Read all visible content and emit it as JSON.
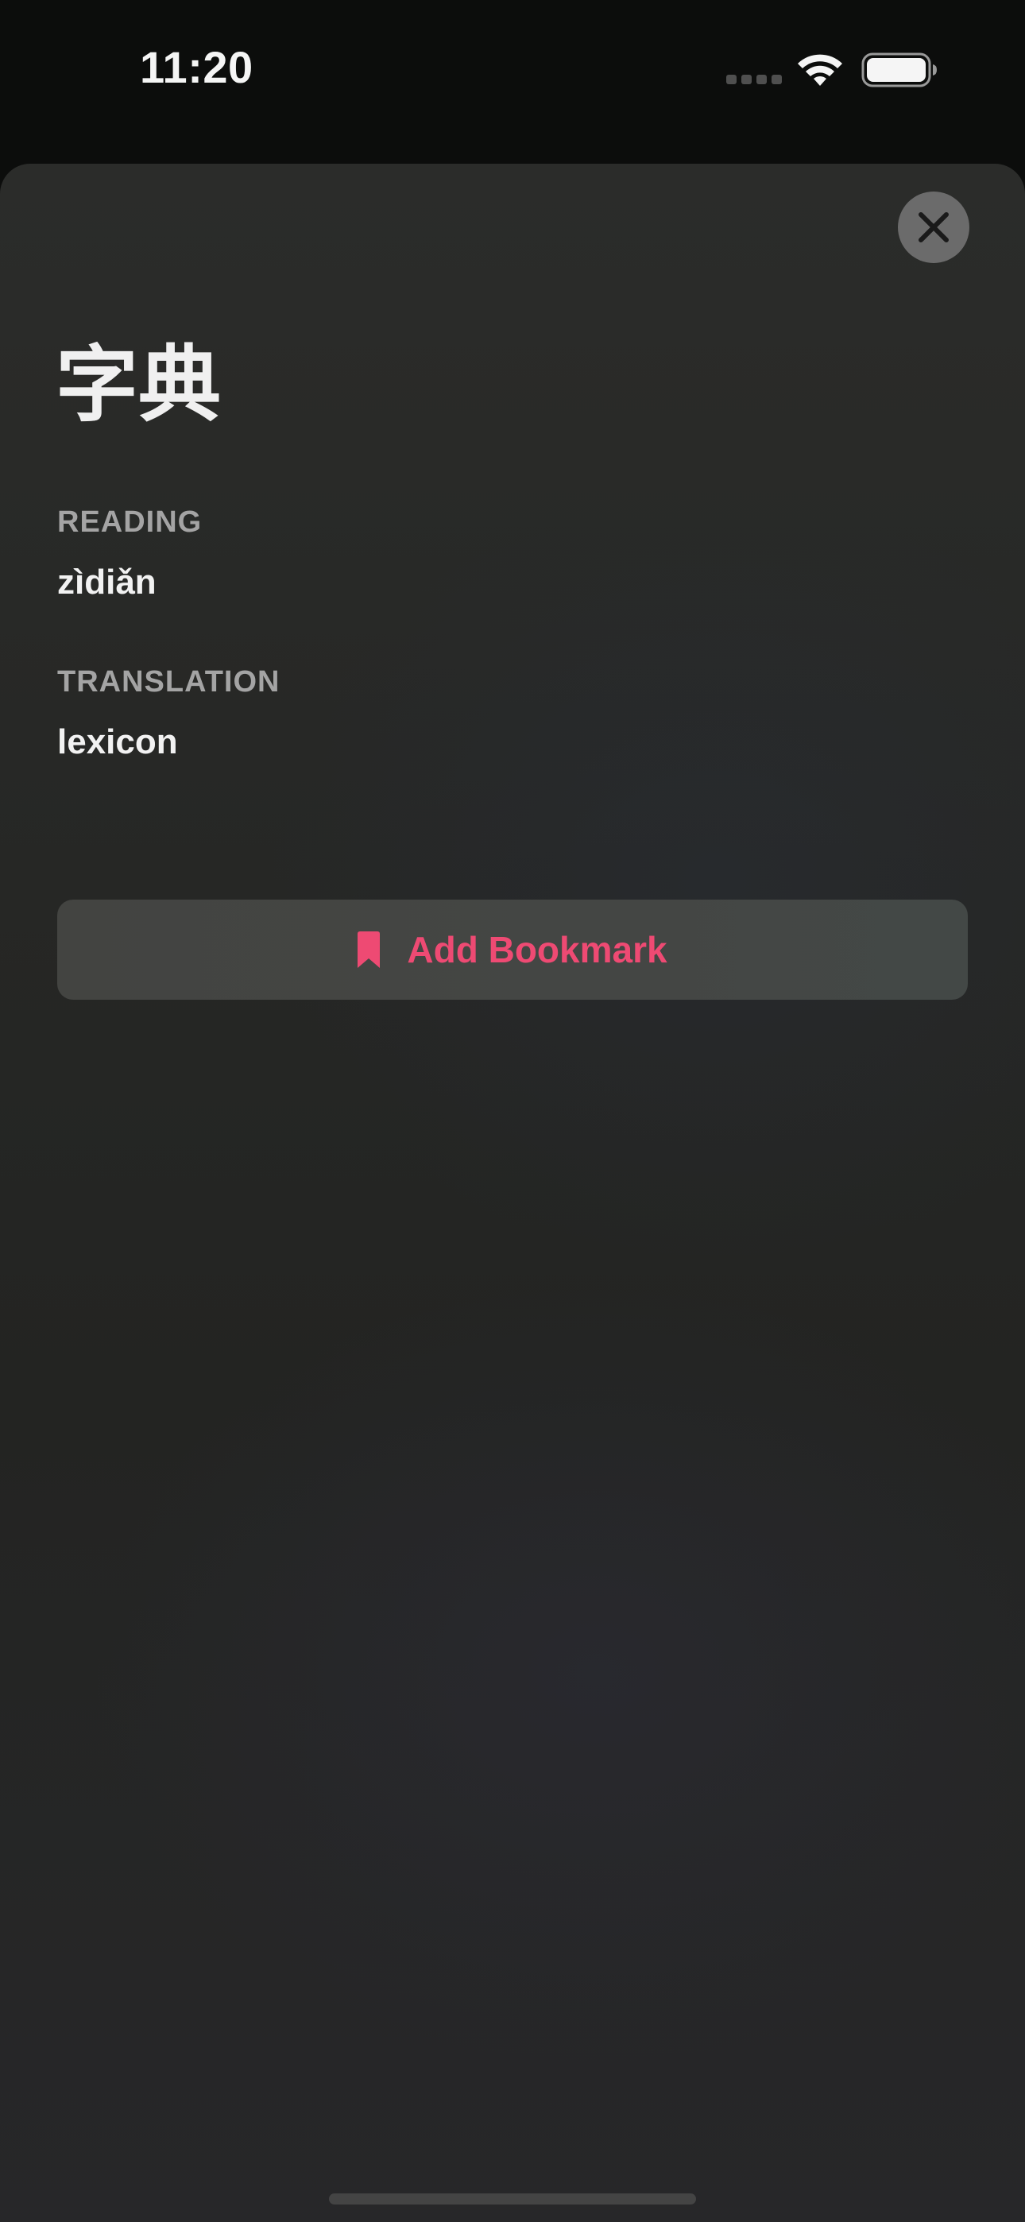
{
  "status_bar": {
    "time": "11:20",
    "signal_icon": "cellular-signal-icon",
    "wifi_icon": "wifi-icon",
    "battery_icon": "battery-icon"
  },
  "sheet": {
    "close_icon": "close-icon",
    "term": "字典",
    "reading_label": "READING",
    "reading_value": "zìdiǎn",
    "translation_label": "TRANSLATION",
    "translation_value": "lexicon",
    "bookmark_icon": "bookmark-icon",
    "bookmark_button_label": "Add Bookmark"
  },
  "colors": {
    "accent": "#ee4a73",
    "sheet_background": "#262725",
    "label": "#a4a4a4",
    "text": "#f2f2f2"
  }
}
